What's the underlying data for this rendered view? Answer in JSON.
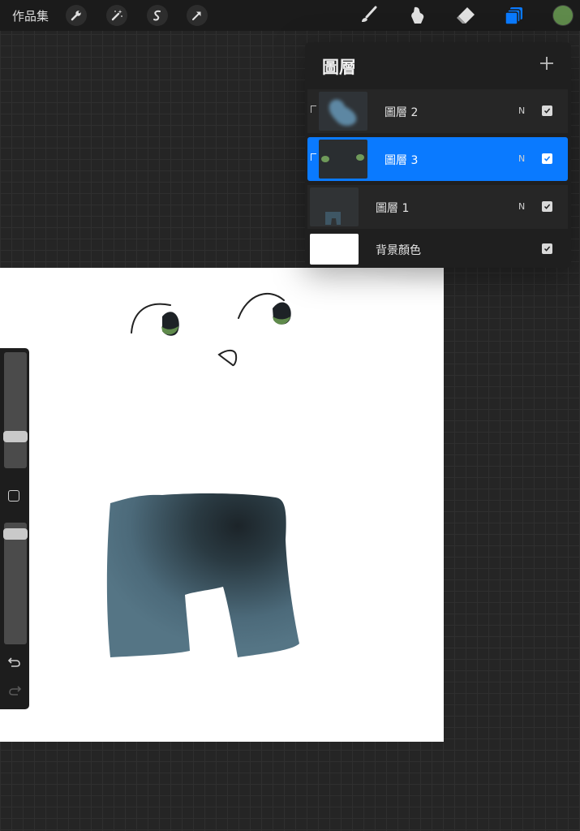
{
  "toolbar": {
    "gallery_label": "作品集",
    "tools_left": [
      "wrench-icon",
      "magic-wand-icon",
      "selection-icon",
      "transform-arrow-icon"
    ],
    "tools_right": [
      "brush-icon",
      "smudge-icon",
      "eraser-icon",
      "layers-icon"
    ],
    "active_tool": "layers-icon",
    "current_color": "#5f8a4b"
  },
  "layers_panel": {
    "title": "圖層",
    "add_label": "+",
    "layers": [
      {
        "name": "圖層 2",
        "blend": "N",
        "visible": true,
        "selected": false,
        "clipped": true
      },
      {
        "name": "圖層 3",
        "blend": "N",
        "visible": true,
        "selected": true,
        "clipped": true
      },
      {
        "name": "圖層 1",
        "blend": "N",
        "visible": true,
        "selected": false,
        "clipped": false
      },
      {
        "name": "背景顏色",
        "blend": "",
        "visible": true,
        "selected": false,
        "clipped": false
      }
    ],
    "accent_color": "#0a7aff"
  },
  "sidebar": {
    "brush_size": 0.25,
    "brush_opacity": 0.95,
    "icons": [
      "modify-square-icon",
      "undo-icon",
      "redo-icon"
    ]
  }
}
